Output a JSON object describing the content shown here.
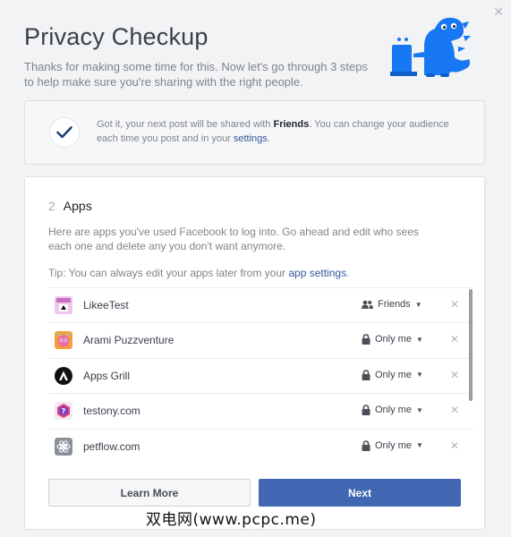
{
  "dialog": {
    "title": "Privacy Checkup",
    "subtitle": "Thanks for making some time for this. Now let's go through 3 steps to help make sure you're sharing with the right people.",
    "close_icon": "close-icon"
  },
  "notice": {
    "text_before": "Got it, your next post will be shared with ",
    "audience": "Friends",
    "text_after": ". You can change your audience each time you post and in your ",
    "link": "settings",
    "text_end": "."
  },
  "step": {
    "number": "2",
    "name": "Apps",
    "description": "Here are apps you've used Facebook to log into. Go ahead and edit who sees each one and delete any you don't want anymore.",
    "tip_before": "Tip: You can always edit your apps later from your ",
    "tip_link": "app settings",
    "tip_end": "."
  },
  "apps": [
    {
      "name": "LikeeTest",
      "audience": "Friends",
      "audience_icon": "friends-icon",
      "icon": "likeetest-app-icon"
    },
    {
      "name": "Arami Puzzventure",
      "audience": "Only me",
      "audience_icon": "lock-icon",
      "icon": "arami-puzzventure-app-icon"
    },
    {
      "name": "Apps Grill",
      "audience": "Only me",
      "audience_icon": "lock-icon",
      "icon": "apps-grill-app-icon"
    },
    {
      "name": "testony.com",
      "audience": "Only me",
      "audience_icon": "lock-icon",
      "icon": "testony-app-icon"
    },
    {
      "name": "petflow.com",
      "audience": "Only me",
      "audience_icon": "lock-icon",
      "icon": "petflow-app-icon"
    }
  ],
  "buttons": {
    "learn_more": "Learn More",
    "next": "Next"
  },
  "watermark": "双电网(www.pcpc.me)",
  "colors": {
    "brand_blue": "#4267b2",
    "link": "#365899",
    "dino": "#1877f2",
    "background": "#f2f3f5"
  }
}
